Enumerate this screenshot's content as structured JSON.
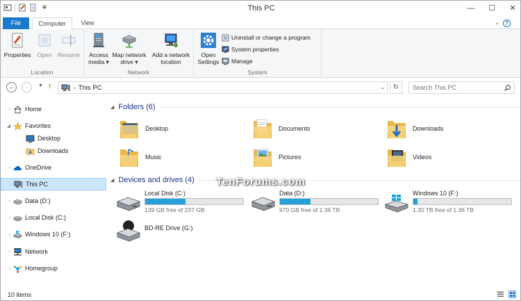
{
  "window": {
    "title": "This PC"
  },
  "tabs": {
    "file": "File",
    "computer": "Computer",
    "view": "View"
  },
  "ribbon": {
    "location": {
      "label": "Location",
      "properties": "Properties",
      "open": "Open",
      "rename": "Rename"
    },
    "network": {
      "label": "Network",
      "access_media_1": "Access",
      "access_media_2": "media ▾",
      "map_drive_1": "Map network",
      "map_drive_2": "drive ▾",
      "add_location_1": "Add a network",
      "add_location_2": "location"
    },
    "system": {
      "label": "System",
      "open_settings_1": "Open",
      "open_settings_2": "Settings",
      "uninstall": "Uninstall or change a program",
      "system_properties": "System properties",
      "manage": "Manage"
    }
  },
  "address": {
    "location": "This PC",
    "search_placeholder": "Search This PC"
  },
  "nav": {
    "home": "Home",
    "favorites": "Favorites",
    "desktop": "Desktop",
    "downloads": "Downloads",
    "onedrive": "OneDrive",
    "this_pc": "This PC",
    "data_d": "Data (D:)",
    "local_c": "Local Disk (C:)",
    "win10_f": "Windows 10 (F:)",
    "network": "Network",
    "homegroup": "Homegroup"
  },
  "folders": {
    "header": "Folders (6)",
    "items": [
      "Desktop",
      "Documents",
      "Downloads",
      "Music",
      "Pictures",
      "Videos"
    ]
  },
  "drives": {
    "header": "Devices and drives (4)",
    "items": [
      {
        "name": "Local Disk (C:)",
        "free": "139 GB free of 237 GB",
        "used_fraction": 0.41
      },
      {
        "name": "Data (D:)",
        "free": "970 GB free of 1.36 TB",
        "used_fraction": 0.31
      },
      {
        "name": "Windows 10 (F:)",
        "free": "1.30 TB free of 1.36 TB",
        "used_fraction": 0.04
      },
      {
        "name": "BD-RE Drive (G:)"
      }
    ]
  },
  "watermark": "TenForums.com",
  "status": {
    "count": "10 items"
  },
  "colors": {
    "accent": "#1979ca",
    "selection": "#cce8ff",
    "drive_bar": "#26a0da",
    "folder": "#f6d37a"
  }
}
